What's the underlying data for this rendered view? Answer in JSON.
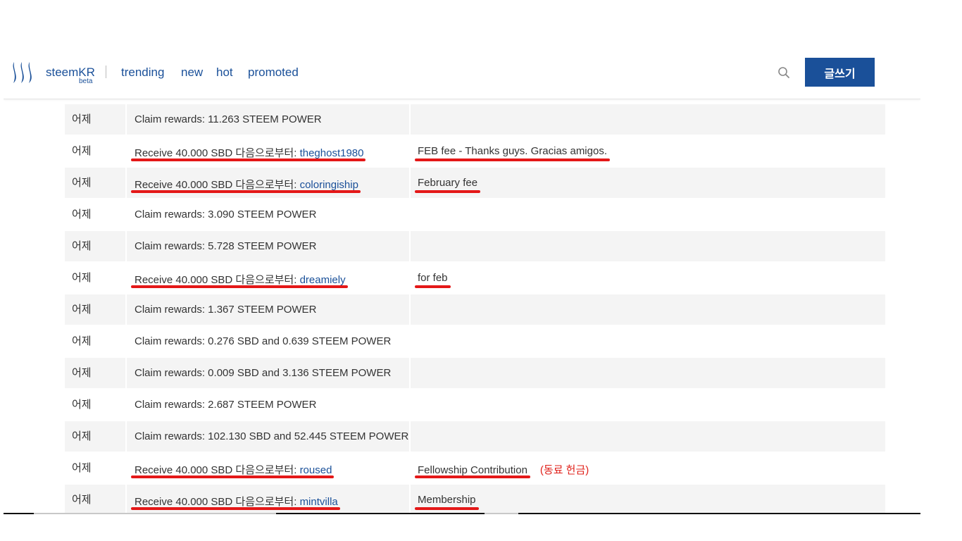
{
  "header": {
    "brand": "steemKR",
    "brand_sub": "beta",
    "nav": [
      "trending",
      "new",
      "hot",
      "promoted"
    ],
    "write_label": "글쓰기",
    "search_icon": "search-icon",
    "logo_icon": "steem-logo-icon"
  },
  "colors": {
    "accent": "#1a5099",
    "underline": "#e41818",
    "row_shade": "#f4f4f4"
  },
  "rows": [
    {
      "date": "어제",
      "text": "Claim rewards: 11.263 STEEM POWER",
      "account": "",
      "memo": "",
      "note": "",
      "shade": true
    },
    {
      "date": "어제",
      "text": "Receive 40.000 SBD 다음으로부터: ",
      "account": "theghost1980",
      "memo": "FEB fee - Thanks guys. Gracias amigos.",
      "note": "",
      "shade": false
    },
    {
      "date": "어제",
      "text": "Receive 40.000 SBD 다음으로부터: ",
      "account": "coloringiship",
      "memo": "February fee",
      "note": "",
      "shade": true
    },
    {
      "date": "어제",
      "text": "Claim rewards: 3.090 STEEM POWER",
      "account": "",
      "memo": "",
      "note": "",
      "shade": false
    },
    {
      "date": "어제",
      "text": "Claim rewards: 5.728 STEEM POWER",
      "account": "",
      "memo": "",
      "note": "",
      "shade": true
    },
    {
      "date": "어제",
      "text": "Receive 40.000 SBD 다음으로부터: ",
      "account": "dreamiely",
      "memo": "for feb",
      "note": "",
      "shade": false
    },
    {
      "date": "어제",
      "text": "Claim rewards: 1.367 STEEM POWER",
      "account": "",
      "memo": "",
      "note": "",
      "shade": true
    },
    {
      "date": "어제",
      "text": "Claim rewards: 0.276 SBD and 0.639 STEEM POWER",
      "account": "",
      "memo": "",
      "note": "",
      "shade": false
    },
    {
      "date": "어제",
      "text": "Claim rewards: 0.009 SBD and 3.136 STEEM POWER",
      "account": "",
      "memo": "",
      "note": "",
      "shade": true
    },
    {
      "date": "어제",
      "text": "Claim rewards: 2.687 STEEM POWER",
      "account": "",
      "memo": "",
      "note": "",
      "shade": false
    },
    {
      "date": "어제",
      "text": "Claim rewards: 102.130 SBD and 52.445 STEEM POWER",
      "account": "",
      "memo": "",
      "note": "",
      "shade": true
    },
    {
      "date": "어제",
      "text": "Receive 40.000 SBD 다음으로부터: ",
      "account": "roused",
      "memo": "Fellowship Contribution",
      "note": "(동료 헌금)",
      "shade": false
    },
    {
      "date": "어제",
      "text": "Receive 40.000 SBD 다음으로부터: ",
      "account": "mintvilla",
      "memo": "Membership",
      "note": "",
      "shade": true
    }
  ]
}
